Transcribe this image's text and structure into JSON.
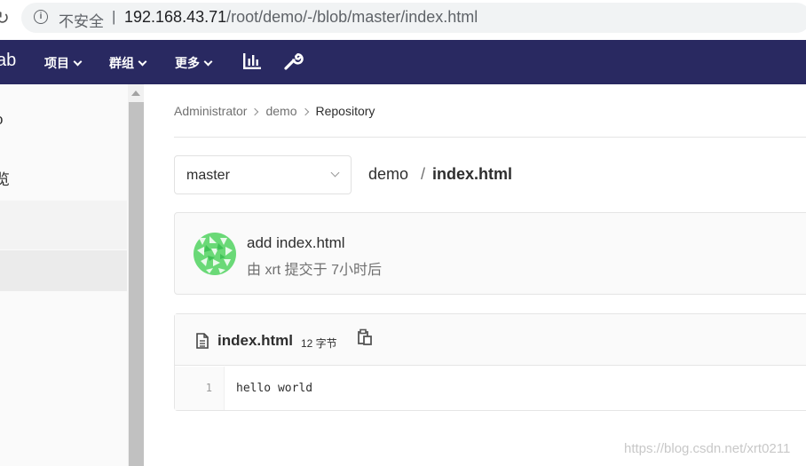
{
  "browser": {
    "security_label": "不安全",
    "url_host": "192.168.43.71",
    "url_path": "/root/demo/-/blob/master/index.html"
  },
  "navbar": {
    "brand_fragment": "ab",
    "items": [
      {
        "label": "项目"
      },
      {
        "label": "群组"
      },
      {
        "label": "更多"
      }
    ]
  },
  "sidebar": {
    "item_1": "o",
    "item_2": "览"
  },
  "breadcrumb": [
    "Administrator",
    "demo",
    "Repository"
  ],
  "branch_selector": {
    "value": "master"
  },
  "file_path": {
    "project": "demo",
    "file": "index.html"
  },
  "commit": {
    "title": "add index.html",
    "meta": "由 xrt 提交于 7小时后"
  },
  "file": {
    "name": "index.html",
    "size": "12 字节",
    "lines": [
      {
        "number": "1",
        "text": "hello world"
      }
    ]
  },
  "watermark": "https://blog.csdn.net/xrt0211",
  "colors": {
    "navbar": "#292961",
    "sidebar_active": "#ebebeb",
    "avatar": "#6ad977"
  }
}
